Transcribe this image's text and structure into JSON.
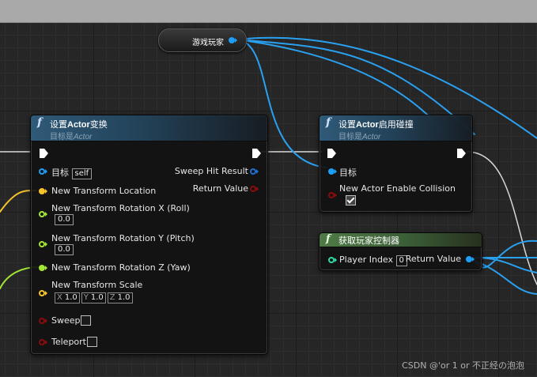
{
  "colors": {
    "exec": "#ffffff",
    "object": "#1e9ef7",
    "vector": "#f6c32b",
    "rotator": "#a3e635",
    "float": "#a3e635",
    "bool": "#8b0c0c",
    "hit_result": "#1e6fd1",
    "int": "#2fd9a7"
  },
  "variable_node": {
    "label": "游戏玩家"
  },
  "set_transform_node": {
    "icon": "function-icon",
    "title_prefix": "设置",
    "title_bold": "Actor",
    "title_suffix": "变换",
    "subtitle_prefix": "目标是",
    "subtitle_target": "Actor",
    "target_label": "目标",
    "target_value": "self",
    "location_label": "New Transform Location",
    "rotation_x_label": "New Transform Rotation X (Roll)",
    "rotation_x_value": "0.0",
    "rotation_y_label": "New Transform Rotation Y (Pitch)",
    "rotation_y_value": "0.0",
    "rotation_z_label": "New Transform Rotation Z (Yaw)",
    "scale_label": "New Transform Scale",
    "scale_x_axis": "X",
    "scale_x": "1.0",
    "scale_y_axis": "Y",
    "scale_y": "1.0",
    "scale_z_axis": "Z",
    "scale_z": "1.0",
    "sweep_label": "Sweep",
    "teleport_label": "Teleport",
    "sweep_hit_label": "Sweep Hit Result",
    "return_label": "Return Value"
  },
  "set_collision_node": {
    "icon": "function-icon",
    "title_prefix": "设置",
    "title_bold": "Actor",
    "title_suffix": "启用碰撞",
    "subtitle_prefix": "目标是",
    "subtitle_target": "Actor",
    "target_label": "目标",
    "enable_label": "New Actor Enable Collision",
    "enable_checked": true
  },
  "get_controller_node": {
    "icon": "function-icon",
    "title": "获取玩家控制器",
    "player_index_label": "Player Index",
    "player_index_value": "0",
    "return_label": "Return Value"
  },
  "watermark": "CSDN @'or 1 or 不正经の泡泡"
}
